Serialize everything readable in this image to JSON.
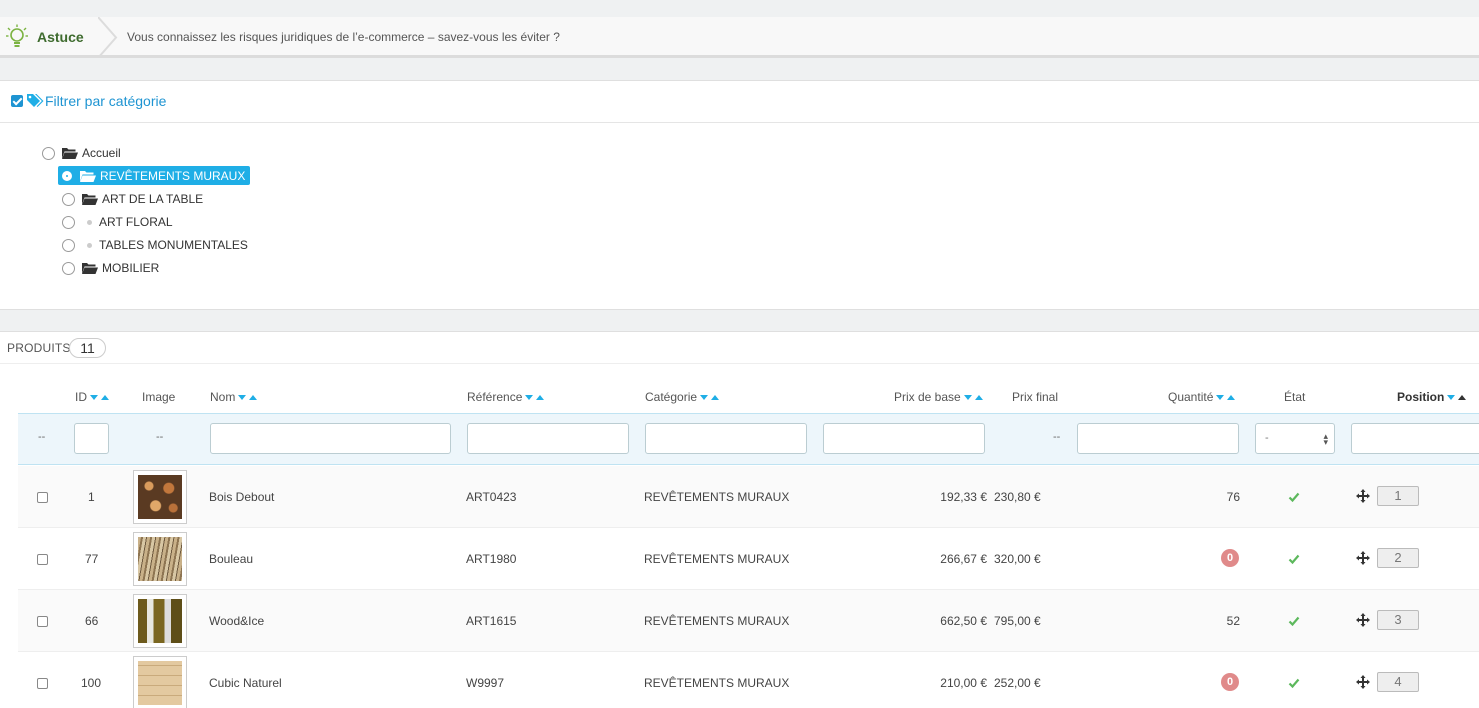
{
  "tip": {
    "label": "Astuce",
    "text": "Vous connaissez les risques juridiques de l’e-commerce – savez-vous les éviter ?"
  },
  "filter": {
    "title": "Filtrer par catégorie",
    "tree": [
      {
        "label": "Accueil",
        "icon": "folder-open-icon",
        "selected": false
      },
      {
        "label": "REVÊTEMENTS MURAUX",
        "icon": "folder-open-icon",
        "selected": true
      },
      {
        "label": "ART DE LA TABLE",
        "icon": "folder-open-icon",
        "selected": false
      },
      {
        "label": "ART FLORAL",
        "icon": "dot-icon",
        "selected": false
      },
      {
        "label": "TABLES MONUMENTALES",
        "icon": "dot-icon",
        "selected": false
      },
      {
        "label": "MOBILIER",
        "icon": "folder-open-icon",
        "selected": false
      }
    ]
  },
  "products": {
    "title": "PRODUITS",
    "count": "11",
    "columns": {
      "id": "ID",
      "image": "Image",
      "name": "Nom",
      "reference": "Référence",
      "category": "Catégorie",
      "base_price": "Prix de base",
      "final_price": "Prix final",
      "quantity": "Quantité",
      "state": "État",
      "position": "Position"
    },
    "filters": {
      "dash": "--",
      "state_select": "-"
    },
    "rows": [
      {
        "id": "1",
        "name": "Bois Debout",
        "reference": "ART0423",
        "category": "REVÊTEMENTS MURAUX",
        "base_price": "192,33 €",
        "final_price": "230,80 €",
        "quantity": "76",
        "position": "1"
      },
      {
        "id": "77",
        "name": "Bouleau",
        "reference": "ART1980",
        "category": "REVÊTEMENTS MURAUX",
        "base_price": "266,67 €",
        "final_price": "320,00 €",
        "quantity": "0",
        "position": "2"
      },
      {
        "id": "66",
        "name": "Wood&Ice",
        "reference": "ART1615",
        "category": "REVÊTEMENTS MURAUX",
        "base_price": "662,50 €",
        "final_price": "795,00 €",
        "quantity": "52",
        "position": "3"
      },
      {
        "id": "100",
        "name": "Cubic Naturel",
        "reference": "W9997",
        "category": "REVÊTEMENTS MURAUX",
        "base_price": "210,00 €",
        "final_price": "252,00 €",
        "quantity": "0",
        "position": "4"
      }
    ]
  },
  "colors": {
    "accent": "#1faee6",
    "tip_green": "#3e6b2e",
    "badge_red": "#e08a8a",
    "ok_green": "#5cb85c"
  }
}
